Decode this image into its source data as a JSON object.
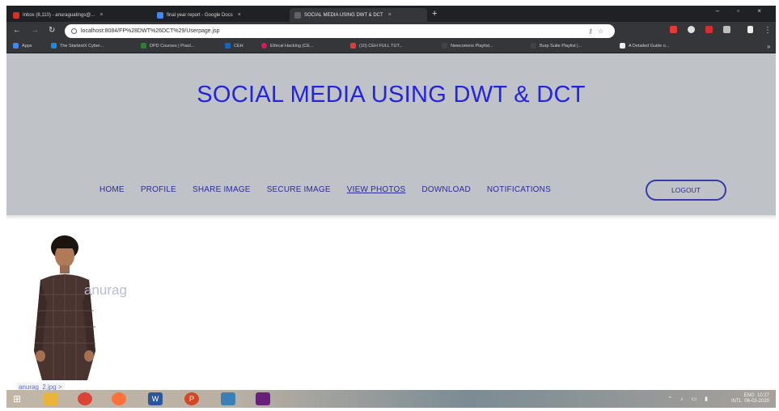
{
  "browser": {
    "tabs": [
      {
        "title": "Inbox (8,110) - anuraguatings@...",
        "color": "#d93025"
      },
      {
        "title": "final year report - Google Docs",
        "color": "#4285f4"
      },
      {
        "title": "SOCIAL MEDIA USING DWT & DCT",
        "color": "#5f6368"
      }
    ],
    "new_tab": "+",
    "window_controls": "– ▫ ×",
    "url": "localhost:8084/FP%28DWT%26DCT%29/Userpage.jsp",
    "bookmarks": [
      {
        "label": "Apps",
        "color": "#4285f4"
      },
      {
        "label": "The StarbiotX Cyber...",
        "color": "#1e88e5"
      },
      {
        "label": "DPD Courses | Pract...",
        "color": "#2e7d32"
      },
      {
        "label": "CEH",
        "color": "#1565c0"
      },
      {
        "label": "Ethical Hacking (CE...",
        "color": "#d81b60"
      },
      {
        "label": "(10) CEH FULL TUT...",
        "color": "#e53935"
      },
      {
        "label": "Newcomers Playlist...",
        "color": "#424242"
      },
      {
        "label": "Burp Suite Playlist |...",
        "color": "#424242"
      },
      {
        "label": "A Detailed Guide o...",
        "color": "#eeeeee"
      }
    ]
  },
  "site": {
    "title": "SOCIAL MEDIA USING DWT & DCT",
    "nav": [
      "HOME",
      "PROFILE",
      "SHARE IMAGE",
      "SECURE IMAGE",
      "VIEW PHOTOS",
      "DOWNLOAD",
      "NOTIFICATIONS"
    ],
    "active_nav": "VIEW PHOTOS",
    "logout_label": "LOGOUT"
  },
  "content": {
    "username": "anurag",
    "status_text": "anurag_2.jpg >"
  },
  "taskbar": {
    "apps": [
      {
        "name": "windows-start",
        "color": "#2d7be5"
      },
      {
        "name": "file-explorer",
        "color": "#e8b43a"
      },
      {
        "name": "chrome",
        "color": "#db4437"
      },
      {
        "name": "firefox",
        "color": "#ff7139"
      },
      {
        "name": "word",
        "color": "#2b579a"
      },
      {
        "name": "powerpoint",
        "color": "#d24726"
      },
      {
        "name": "virtualbox",
        "color": "#3c7fb5"
      },
      {
        "name": "visual-studio",
        "color": "#68217a"
      }
    ],
    "lang": "ENG",
    "region": "INTL",
    "time": "10:27",
    "date": "06-03-2020"
  }
}
